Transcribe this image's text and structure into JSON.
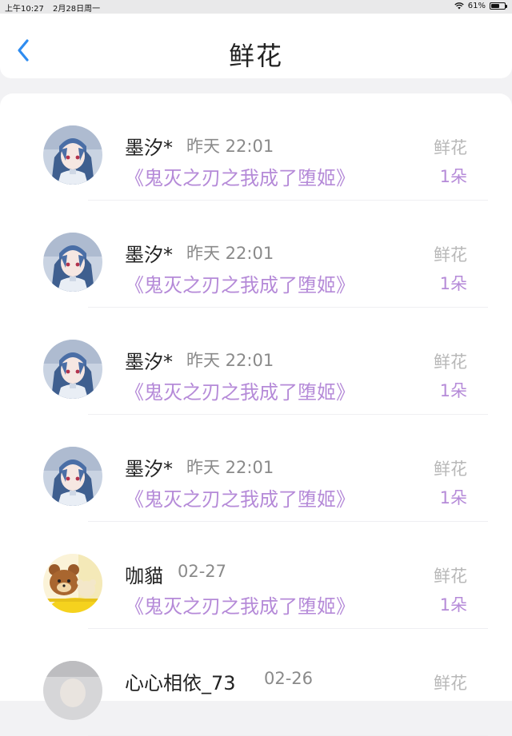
{
  "statusbar": {
    "time": "上午10:27",
    "date": "2月28日周一",
    "battery": "61%",
    "battery_level": 0.61
  },
  "header": {
    "title": "鲜花",
    "back_icon": "chevron-left-icon"
  },
  "items": [
    {
      "user": "墨汐*",
      "time": "昨天 22:01",
      "book": "《鬼灭之刃之我成了堕姬》",
      "gift": "鲜花",
      "count": "1朵",
      "avatar": "anime-girl-avatar"
    },
    {
      "user": "墨汐*",
      "time": "昨天 22:01",
      "book": "《鬼灭之刃之我成了堕姬》",
      "gift": "鲜花",
      "count": "1朵",
      "avatar": "anime-girl-avatar"
    },
    {
      "user": "墨汐*",
      "time": "昨天 22:01",
      "book": "《鬼灭之刃之我成了堕姬》",
      "gift": "鲜花",
      "count": "1朵",
      "avatar": "anime-girl-avatar"
    },
    {
      "user": "墨汐*",
      "time": "昨天 22:01",
      "book": "《鬼灭之刃之我成了堕姬》",
      "gift": "鲜花",
      "count": "1朵",
      "avatar": "anime-girl-avatar"
    },
    {
      "user": "咖貓",
      "time": "02-27",
      "book": "《鬼灭之刃之我成了堕姬》",
      "gift": "鲜花",
      "count": "1朵",
      "avatar": "bear-avatar"
    },
    {
      "user": "心心相依_73",
      "time": "02-26",
      "book": "",
      "gift": "鲜花",
      "count": "",
      "avatar": "grey-avatar"
    }
  ],
  "colors": {
    "accent_purple": "#b58ad8",
    "back_blue": "#2e8cf0"
  }
}
